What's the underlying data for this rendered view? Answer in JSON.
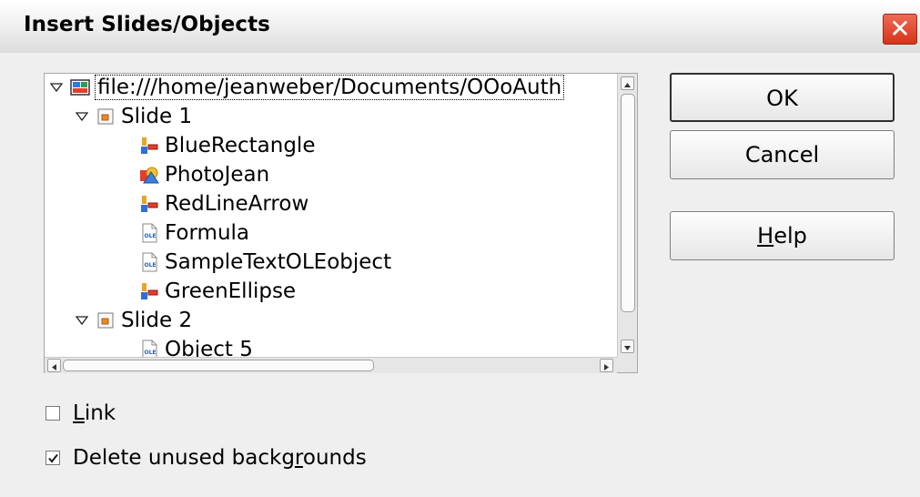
{
  "dialog": {
    "title": "Insert Slides/Objects",
    "close_label": "✕"
  },
  "tree": {
    "root": {
      "label": "file:///home/jeanweber/Documents/OOoAuth",
      "icon": "presentation-file-icon"
    },
    "items": [
      {
        "label": "Slide 1",
        "icon": "slide-icon",
        "expanded": true
      },
      {
        "label": "BlueRectangle",
        "icon": "draw-shape-icon"
      },
      {
        "label": "PhotoJean",
        "icon": "image-object-icon"
      },
      {
        "label": "RedLineArrow",
        "icon": "draw-shape-icon"
      },
      {
        "label": "Formula",
        "icon": "ole-object-icon"
      },
      {
        "label": "SampleTextOLEobject",
        "icon": "ole-object-icon"
      },
      {
        "label": "GreenEllipse",
        "icon": "draw-shape-icon"
      },
      {
        "label": "Slide 2",
        "icon": "slide-icon",
        "expanded": true
      },
      {
        "label": "Object 5",
        "icon": "ole-object-icon"
      }
    ]
  },
  "buttons": {
    "ok": "OK",
    "cancel": "Cancel",
    "help_mnemonic": "H",
    "help_rest": "elp"
  },
  "options": {
    "link": {
      "mnemonic": "L",
      "rest": "ink",
      "checked": false
    },
    "delete_backgrounds": {
      "pre": "Delete unused backg",
      "mnemonic": "r",
      "post": "ounds",
      "checked": true
    }
  },
  "colors": {
    "close_button": "#d63419",
    "window_bg": "#efefef"
  }
}
